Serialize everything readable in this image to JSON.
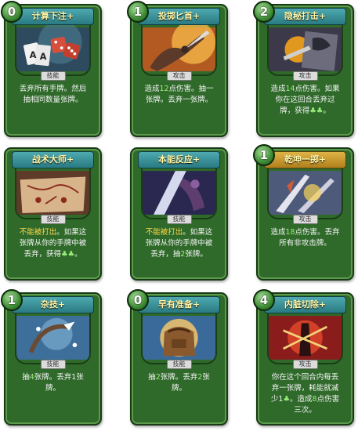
{
  "cards": [
    {
      "cost": "0",
      "title": "计算下注+",
      "type": "技能",
      "banner_style": "skill",
      "desc": [
        {
          "t": "丢弃所有手牌。然后抽相同数量张牌。",
          "c": ""
        }
      ]
    },
    {
      "cost": "1",
      "title": "投掷匕首+",
      "type": "攻击",
      "banner_style": "skill",
      "desc": [
        {
          "t": "造成",
          "c": ""
        },
        {
          "t": "12",
          "c": "hl"
        },
        {
          "t": "点伤害。抽一张牌。丢弃一张牌。",
          "c": ""
        }
      ]
    },
    {
      "cost": "2",
      "title": "隐秘打击+",
      "type": "攻击",
      "banner_style": "skill",
      "desc": [
        {
          "t": "造成",
          "c": ""
        },
        {
          "t": "14",
          "c": "hl"
        },
        {
          "t": "点伤害。如果你在这回合丢弃过牌，获得",
          "c": ""
        },
        {
          "t": "♣♣",
          "c": "hl"
        },
        {
          "t": "。",
          "c": ""
        }
      ]
    },
    {
      "cost": "",
      "title": "战术大师+",
      "type": "技能",
      "banner_style": "skill",
      "desc": [
        {
          "t": "不能被打出",
          "c": "warn"
        },
        {
          "t": "。如果这张牌从你的手牌中被丢弃，获得",
          "c": ""
        },
        {
          "t": "♣♣",
          "c": "hl"
        },
        {
          "t": "。",
          "c": ""
        }
      ]
    },
    {
      "cost": "",
      "title": "本能反应+",
      "type": "技能",
      "banner_style": "skill",
      "desc": [
        {
          "t": "不能被打出",
          "c": "warn"
        },
        {
          "t": "。如果这张牌从你的手牌中被丢弃，抽",
          "c": ""
        },
        {
          "t": "2",
          "c": "hl"
        },
        {
          "t": "张牌。",
          "c": ""
        }
      ]
    },
    {
      "cost": "1",
      "title": "乾坤一掷+",
      "type": "攻击",
      "banner_style": "attack",
      "desc": [
        {
          "t": "造成",
          "c": ""
        },
        {
          "t": "18",
          "c": "hl"
        },
        {
          "t": "点伤害。丢弃所有非攻击牌。",
          "c": ""
        }
      ]
    },
    {
      "cost": "1",
      "title": "杂技+",
      "type": "技能",
      "banner_style": "skill",
      "desc": [
        {
          "t": "抽",
          "c": ""
        },
        {
          "t": "4",
          "c": "hl"
        },
        {
          "t": "张牌。丢弃1张牌。",
          "c": ""
        }
      ]
    },
    {
      "cost": "0",
      "title": "早有准备+",
      "type": "技能",
      "banner_style": "skill",
      "desc": [
        {
          "t": "抽",
          "c": ""
        },
        {
          "t": "2",
          "c": "hl"
        },
        {
          "t": "张牌。丢弃",
          "c": ""
        },
        {
          "t": "2",
          "c": "hl"
        },
        {
          "t": "张牌。",
          "c": ""
        }
      ]
    },
    {
      "cost": "4",
      "title": "内脏切除+",
      "type": "攻击",
      "banner_style": "skill",
      "desc": [
        {
          "t": "你在这个回合内每丢弃一张牌，耗能就减少1",
          "c": ""
        },
        {
          "t": "♣",
          "c": "hl"
        },
        {
          "t": "。造成",
          "c": ""
        },
        {
          "t": "8",
          "c": "hl"
        },
        {
          "t": "点伤害三次。",
          "c": ""
        }
      ]
    }
  ]
}
